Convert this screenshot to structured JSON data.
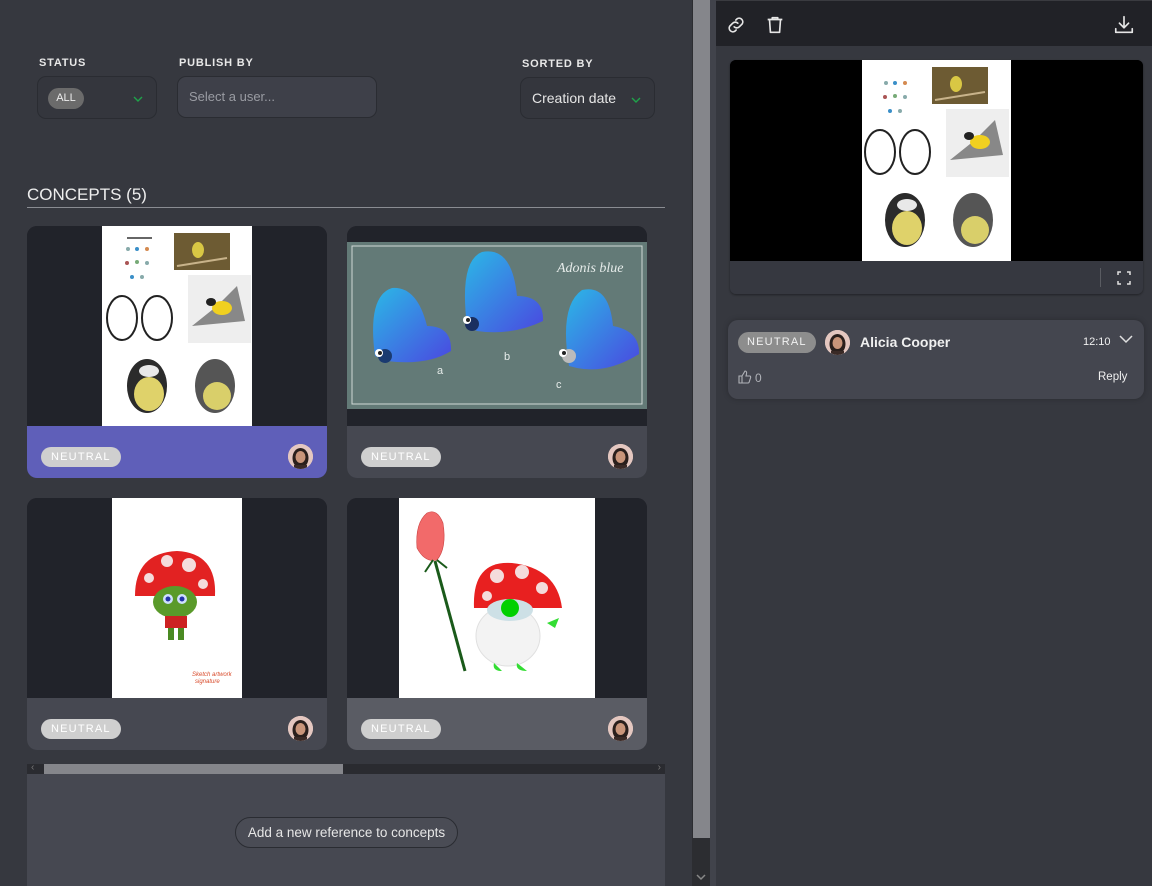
{
  "filters": {
    "status": {
      "label": "STATUS",
      "value": "ALL"
    },
    "publish_by": {
      "label": "PUBLISH BY",
      "placeholder": "Select a user..."
    },
    "sorted_by": {
      "label": "SORTED BY",
      "value": "Creation date"
    }
  },
  "section": {
    "title": "CONCEPTS (5)"
  },
  "cards": [
    {
      "image": "british-tits-reference-sheet",
      "status": "NEUTRAL",
      "selected": true
    },
    {
      "image": "adonis-blue-butterflies",
      "status": "NEUTRAL",
      "selected": false
    },
    {
      "image": "mushroom-goblin",
      "status": "NEUTRAL",
      "selected": false
    },
    {
      "image": "mushroom-gnome-with-rose",
      "status": "NEUTRAL",
      "selected": false
    }
  ],
  "add_reference": {
    "label": "Add a new reference to concepts"
  },
  "right_panel": {
    "toolbar": {
      "icons": [
        "link-icon",
        "trash-icon",
        "download-icon"
      ]
    },
    "preview": {
      "image": "british-tits-reference-sheet"
    },
    "comment": {
      "status": "NEUTRAL",
      "author": "Alicia Cooper",
      "time": "12:10",
      "likes": "0",
      "reply_label": "Reply"
    }
  },
  "colors": {
    "accent_selected": "#5f5fb9",
    "chevron_green": "#1fa34a",
    "background": "#36383f"
  }
}
